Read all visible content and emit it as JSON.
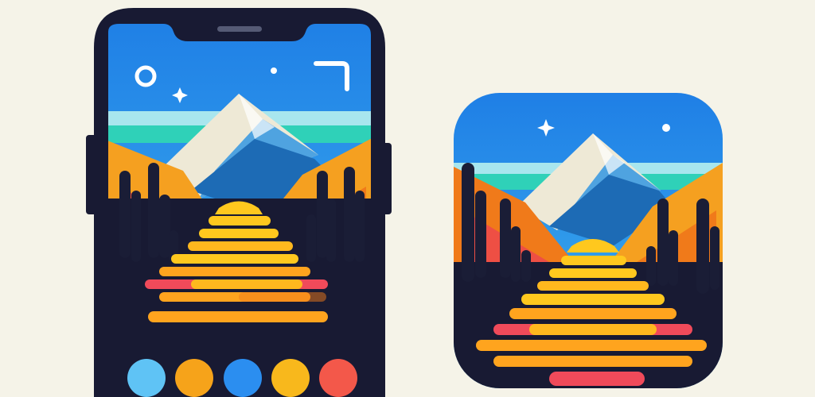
{
  "colors": {
    "background": "#f5f3e8",
    "phone_body": "#181a33",
    "sky_top": "#1f7fe6",
    "sky_bottom": "#3fb4ee",
    "horizon_light": "#a8e6ee",
    "horizon_teal": "#2fd1b8",
    "mountain_snow": "#eee9d6",
    "mountain_blue": "#1d6bb5",
    "mountain_light_blue": "#4fa3e0",
    "hill_orange": "#f5a020",
    "hill_red": "#ee4f44",
    "hill_deep_orange": "#f07a1a",
    "path_yellow": "#ffc81e",
    "path_orange": "#ffa41e",
    "stripe_red": "#f04a5a",
    "tree_dark": "#1a1d36",
    "sparkle_white": "#ffffff"
  },
  "phone": {
    "icons": [
      "circle-icon",
      "sparkle-icon",
      "dot-icon",
      "corner-frame-icon"
    ],
    "color_swatches": [
      {
        "name": "light-blue",
        "hex": "#5fc3f5"
      },
      {
        "name": "amber",
        "hex": "#f6a31a"
      },
      {
        "name": "blue",
        "hex": "#2b8ef0"
      },
      {
        "name": "gold",
        "hex": "#f8b81c"
      },
      {
        "name": "coral",
        "hex": "#f3584a"
      }
    ]
  },
  "app_icon": {
    "icons": [
      "sparkle-icon",
      "dot-icon"
    ]
  }
}
